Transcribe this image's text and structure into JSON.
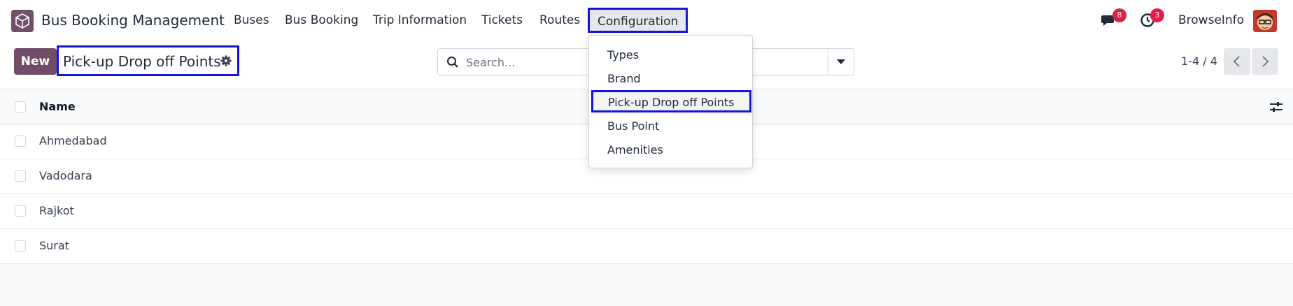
{
  "app": {
    "name": "Bus Booking Management",
    "icon": "package-icon"
  },
  "menu": [
    {
      "label": "Buses"
    },
    {
      "label": "Bus Booking"
    },
    {
      "label": "Trip Information"
    },
    {
      "label": "Tickets"
    },
    {
      "label": "Routes"
    },
    {
      "label": "Configuration"
    }
  ],
  "systray": {
    "messages_badge": "8",
    "activities_badge": "3",
    "company": "BrowseInfo"
  },
  "control": {
    "new_label": "New",
    "page_title": "Pick-up Drop off Points",
    "search_placeholder": "Search...",
    "pager": "1-4 / 4"
  },
  "list": {
    "column_header": "Name",
    "rows": [
      {
        "name": "Ahmedabad"
      },
      {
        "name": "Vadodara"
      },
      {
        "name": "Rajkot"
      },
      {
        "name": "Surat"
      }
    ]
  },
  "dropdown": {
    "items": [
      {
        "label": "Types"
      },
      {
        "label": "Brand"
      },
      {
        "label": "Pick-up Drop off Points"
      },
      {
        "label": "Bus Point"
      },
      {
        "label": "Amenities"
      }
    ]
  },
  "colors": {
    "brand": "#714b67",
    "highlight": "#1414e0",
    "badge": "#e11d48"
  }
}
